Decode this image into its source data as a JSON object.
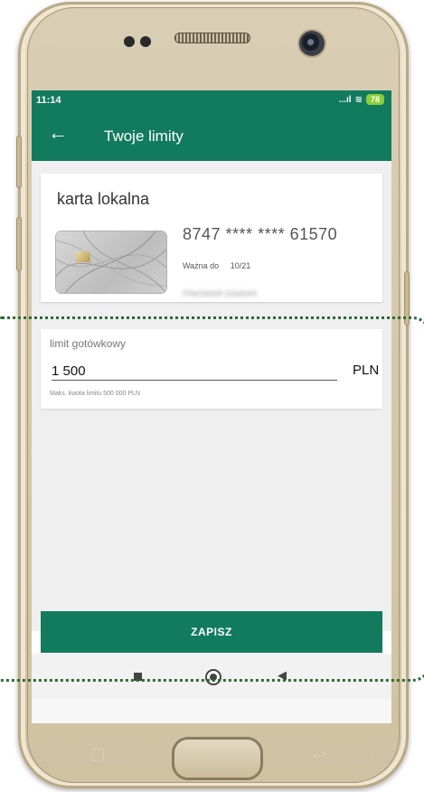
{
  "status_bar": {
    "time": "11:14",
    "signal": "...ıl",
    "wifi": "≋",
    "battery": "78"
  },
  "app_bar": {
    "title": "Twoje limity"
  },
  "card": {
    "name": "karta lokalna",
    "number": "8747 **** **** 61570",
    "valid_label": "Ważna do",
    "valid_value": "10/21",
    "owner": "PIWOWAR DAMIAN"
  },
  "limit": {
    "label": "limit gotówkowy",
    "value": "1 500",
    "currency": "PLN",
    "hint": "Maks. kwota limitu 500 000 PLN"
  },
  "save_label": "ZAPISZ",
  "colors": {
    "brand_green": "#127b5e",
    "highlight": "#2e6b32"
  },
  "icons": {
    "back": "arrow-left-icon",
    "recents": "square-icon",
    "home": "circle-icon",
    "nav_back": "triangle-icon"
  }
}
